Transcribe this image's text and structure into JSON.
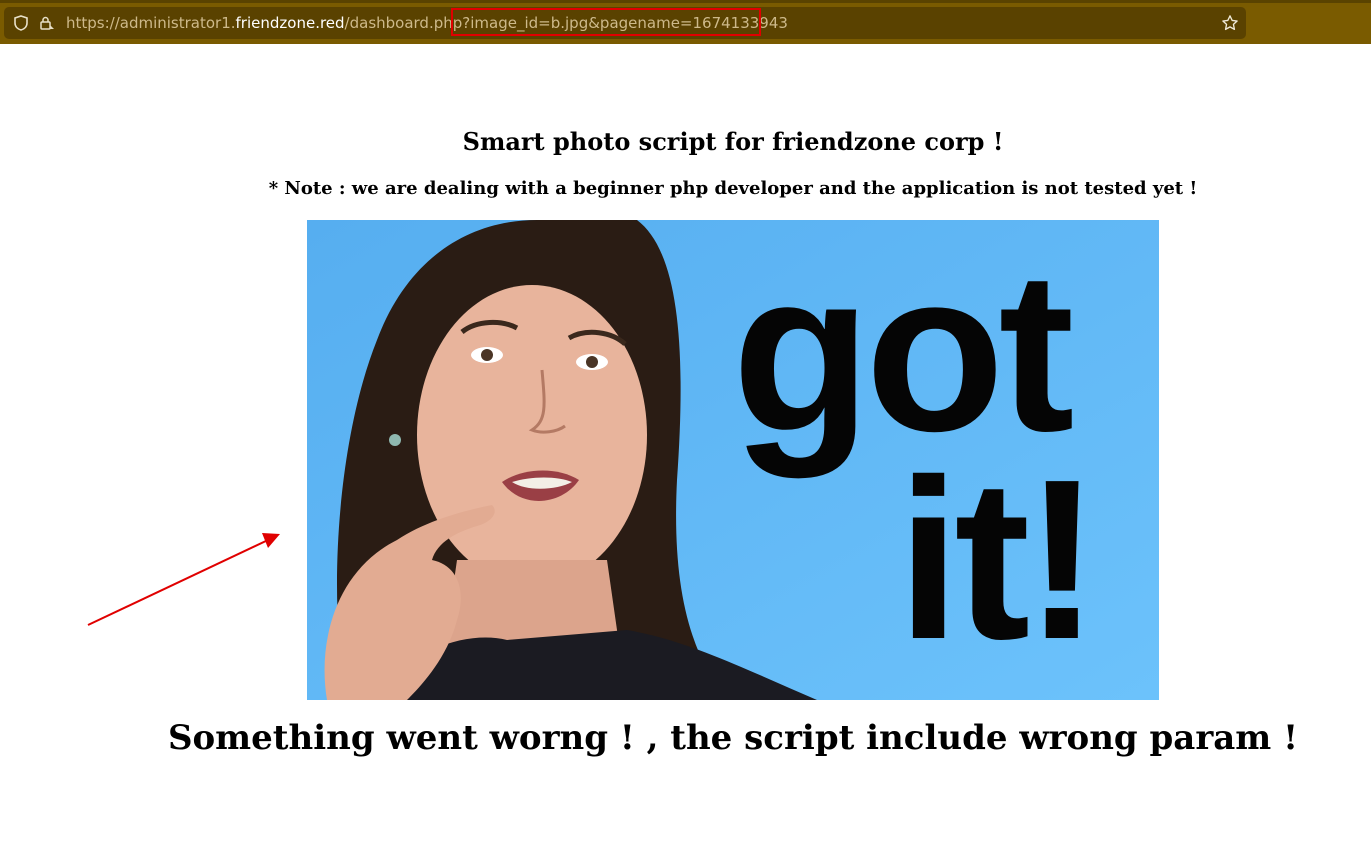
{
  "browser": {
    "url_prefix": "https://administrator1.",
    "url_host": "friendzone.red",
    "url_path": "/dashboard.php",
    "url_query": "?image_id=b.jpg&pagename=1674133943",
    "shield_icon": "shield-icon",
    "lock_icon": "lock-icon",
    "bookmark_icon": "star-icon"
  },
  "page": {
    "title": "Smart photo script for friendzone corp !",
    "note": "* Note : we are dealing with a beginner php developer and the application is not tested yet !",
    "error": "Something went worng ! , the script include wrong param !"
  },
  "image": {
    "text_line1": "got",
    "text_line2": "it!",
    "background_color": "#5cb6f5"
  },
  "annotations": {
    "arrow_color": "#e00000",
    "highlight_color": "#e00000"
  }
}
